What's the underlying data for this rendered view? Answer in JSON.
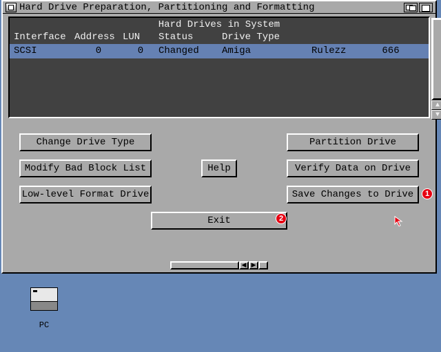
{
  "title": "Hard Drive Preparation, Partitioning and Formatting",
  "panel": {
    "heading": "Hard Drives in System",
    "cols": [
      "Interface",
      "Address",
      "LUN",
      "Status",
      "Drive Type",
      "",
      ""
    ],
    "row": {
      "interface": "SCSI",
      "address": "0",
      "lun": "0",
      "status": "Changed",
      "type1": "Amiga",
      "type2": "Rulezz",
      "num": "666"
    }
  },
  "buttons": {
    "changeDrive": "Change Drive Type",
    "partition": "Partition Drive",
    "modifyBad": "Modify Bad Block List",
    "help": "Help",
    "verify": "Verify Data on Drive",
    "lowlevel": "Low-level Format Drive",
    "save": "Save Changes to Drive",
    "exit": "Exit"
  },
  "markers": {
    "m1": "1",
    "m2": "2"
  },
  "desktop_icon": "PC"
}
